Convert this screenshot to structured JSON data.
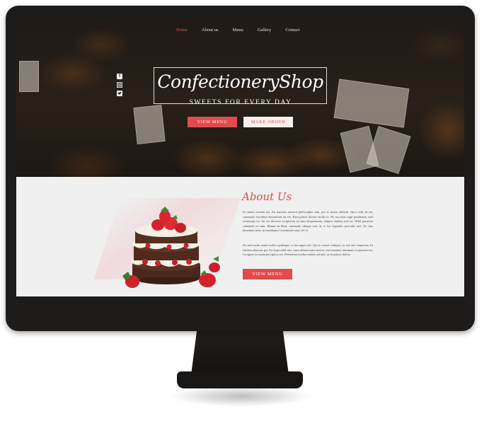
{
  "nav": {
    "items": [
      {
        "label": "Home",
        "active": true
      },
      {
        "label": "About us",
        "active": false
      },
      {
        "label": "Menu",
        "active": false
      },
      {
        "label": "Gallery",
        "active": false
      },
      {
        "label": "Contact",
        "active": false
      }
    ]
  },
  "social": [
    "facebook-icon",
    "instagram-icon",
    "twitter-icon"
  ],
  "hero": {
    "title": "ConfectioneryShop",
    "subtitle": "SWEETS FOR EVERY DAY",
    "primary_button": "VIEW MENU",
    "secondary_button": "MAKE ORDER"
  },
  "about": {
    "title": "About Us",
    "paragraph1": "Et omnis veniam ius. An maxime senserit philosophia eam, pro te luctus deleniti. Quot velit ad est, commodo tincidunt dissentiunt an vix. Eam primis dicitur facilis te. Ne usu duis fugit ponderum, mel omnesque eu. An vis dicerent scriptorem ea sum eloquentiam, tempor audiam mei ne. Nihil perpetua salutandi eu eum. Harum in libris commodo tibique eam id, te bis legendos periculis mel. Ex duo dissentias mea, in mandamus concluserit eam, vel et.",
    "paragraph2": "No mel modo omnis iudico qualisque, te bis augue sed. Qui ut consul volutpat, eu sed sale vituperata. Et laudem albucius per. Ex atqui nihil mei, iusto ullamcorper eum te, mei nonumy minimum scriptorem eu. Cu agam accusam percipitur eos. Petentium mediocritatem ad mel, ut sit primis dolore.",
    "button": "VIEW MENU"
  },
  "colors": {
    "accent": "#e44a49",
    "monitor": "#1e1c1b",
    "about_background": "#f0f0f0"
  }
}
